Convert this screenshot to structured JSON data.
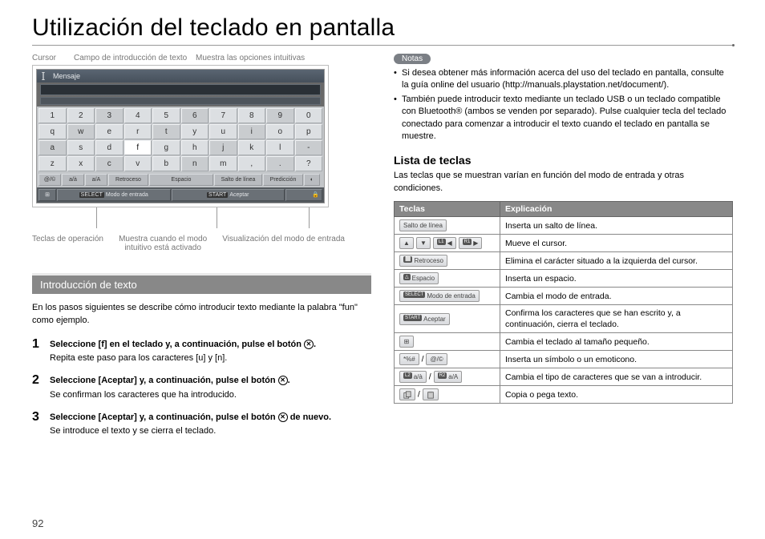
{
  "page_number": "92",
  "title": "Utilización del teclado en pantalla",
  "diagram": {
    "top_labels": [
      "Cursor",
      "Campo de introducción de texto",
      "Muestra las opciones intuitivas"
    ],
    "message_label": "Mensaje",
    "rows": [
      [
        "1",
        "2",
        "3",
        "4",
        "5",
        "6",
        "7",
        "8",
        "9",
        "0"
      ],
      [
        "q",
        "w",
        "e",
        "r",
        "t",
        "y",
        "u",
        "i",
        "o",
        "p"
      ],
      [
        "a",
        "s",
        "d",
        "f",
        "g",
        "h",
        "j",
        "k",
        "l",
        "-"
      ],
      [
        "z",
        "x",
        "c",
        "v",
        "b",
        "n",
        "m",
        ",",
        ".",
        "?"
      ]
    ],
    "op_keys": [
      "@/©",
      "a/à",
      "a/A",
      "Retroceso",
      "Espacio",
      "Salto de línea",
      "Predicción"
    ],
    "bottom_keys": [
      "Modo de entrada",
      "Aceptar"
    ],
    "bottom_badges": [
      "SELECT",
      "START"
    ],
    "lock_icon": "lock-icon",
    "grid_icon": "grid-icon",
    "bottom_labels": [
      "Teclas de operación",
      "Muestra cuando el modo intuitivo está activado",
      "Visualización del modo de entrada"
    ]
  },
  "section_title": "Introducción de texto",
  "section_lead": "En los pasos siguientes se describe cómo introducir texto mediante la palabra \"fun\" como ejemplo.",
  "steps": [
    {
      "title_a": "Seleccione [f] en el teclado y, a continuación, pulse el botón ",
      "title_b": ".",
      "desc": "Repita este paso para los caracteres [u] y [n]."
    },
    {
      "title_a": "Seleccione [Aceptar] y, a continuación, pulse el botón ",
      "title_b": ".",
      "desc": "Se confirman los caracteres que ha introducido."
    },
    {
      "title_a": "Seleccione [Aceptar] y, a continuación, pulse el botón ",
      "title_b": " de nuevo.",
      "desc": "Se introduce el texto y se cierra el teclado."
    }
  ],
  "x_button_glyph": "✕",
  "notes": {
    "badge": "Notas",
    "items": [
      "Si desea obtener más información acerca del uso del teclado en pantalla, consulte la guía online del usuario (http://manuals.playstation.net/document/).",
      "También puede introducir texto mediante un teclado USB o un teclado compatible con Bluetooth® (ambos se venden por separado). Pulse cualquier tecla del teclado conectado para comenzar a introducir el texto cuando el teclado en pantalla se muestre."
    ]
  },
  "keylist": {
    "heading": "Lista de teclas",
    "intro": "Las teclas que se muestran varían en función del modo de entrada y otras condiciones.",
    "th1": "Teclas",
    "th2": "Explicación",
    "rows": [
      {
        "icons": [
          {
            "t": "wider",
            "label": "Salto de línea"
          }
        ],
        "expl": "Inserta un salto de línea."
      },
      {
        "icons": [
          {
            "t": "",
            "label": "▲"
          },
          {
            "t": "",
            "label": "▼"
          },
          {
            "t": "",
            "label": "◀",
            "sup": "L1"
          },
          {
            "t": "",
            "label": "▶",
            "sup": "R1"
          }
        ],
        "expl": "Mueve el cursor."
      },
      {
        "icons": [
          {
            "t": "wide",
            "label": "Retroceso",
            "sup": "⬜"
          }
        ],
        "expl": "Elimina el carácter situado a la izquierda del cursor."
      },
      {
        "icons": [
          {
            "t": "wide",
            "label": "Espacio",
            "sup": "△"
          }
        ],
        "expl": "Inserta un espacio."
      },
      {
        "icons": [
          {
            "t": "wider",
            "label": "Modo de entrada",
            "sup": "SELECT"
          }
        ],
        "expl": "Cambia el modo de entrada."
      },
      {
        "icons": [
          {
            "t": "wide",
            "label": "Aceptar",
            "sup": "START"
          }
        ],
        "expl": "Confirma los caracteres que se han escrito y, a continuación, cierra el teclado."
      },
      {
        "icons": [
          {
            "t": "",
            "label": "⊞"
          }
        ],
        "expl": "Cambia el teclado al tamaño pequeño."
      },
      {
        "icons": [
          {
            "t": "",
            "label": "*%#"
          },
          {
            "slash": true
          },
          {
            "t": "",
            "label": "@/©"
          }
        ],
        "expl": "Inserta un símbolo o un emoticono."
      },
      {
        "icons": [
          {
            "t": "",
            "label": "a/à",
            "sup": "L2"
          },
          {
            "slash": true
          },
          {
            "t": "",
            "label": "a/A",
            "sup": "R2"
          }
        ],
        "expl": "Cambia el tipo de caracteres que se van a introducir."
      },
      {
        "icons": [
          {
            "t": "",
            "svg": "copy"
          },
          {
            "slash": true
          },
          {
            "t": "",
            "svg": "paste"
          }
        ],
        "expl": "Copia o pega texto."
      }
    ]
  }
}
